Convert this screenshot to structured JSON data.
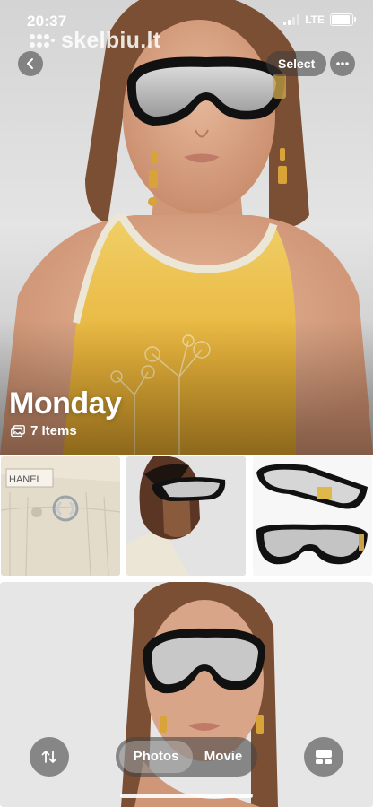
{
  "status_bar": {
    "time": "20:37",
    "network": "LTE",
    "signal_bars": 4,
    "signal_active": 2,
    "battery_level": 0.9
  },
  "watermark": {
    "text": "skelbiu.lt"
  },
  "nav": {
    "back_icon": "chevron-left-icon",
    "select_label": "Select",
    "more_icon": "ellipsis-icon"
  },
  "album": {
    "title": "Monday",
    "count_icon": "photo-stack-icon",
    "count_label": "7 Items"
  },
  "photos": [
    {
      "name": "hero-photo",
      "subject": "woman in shield sunglasses and yellow tank top"
    },
    {
      "name": "thumb-jeans-brooch",
      "brand_text": "HANEL"
    },
    {
      "name": "thumb-profile-sunglasses"
    },
    {
      "name": "thumb-sunglasses-product"
    },
    {
      "name": "lower-photo"
    }
  ],
  "toolbar": {
    "sort_icon": "sort-arrows-icon",
    "tabs": [
      {
        "label": "Photos",
        "active": true
      },
      {
        "label": "Movie",
        "active": false
      }
    ],
    "layout_icon": "grid-layout-icon"
  },
  "colors": {
    "accent_yellow": "#e8b73c",
    "overlay_button": "#464646",
    "text_on_photo": "#ffffff"
  }
}
